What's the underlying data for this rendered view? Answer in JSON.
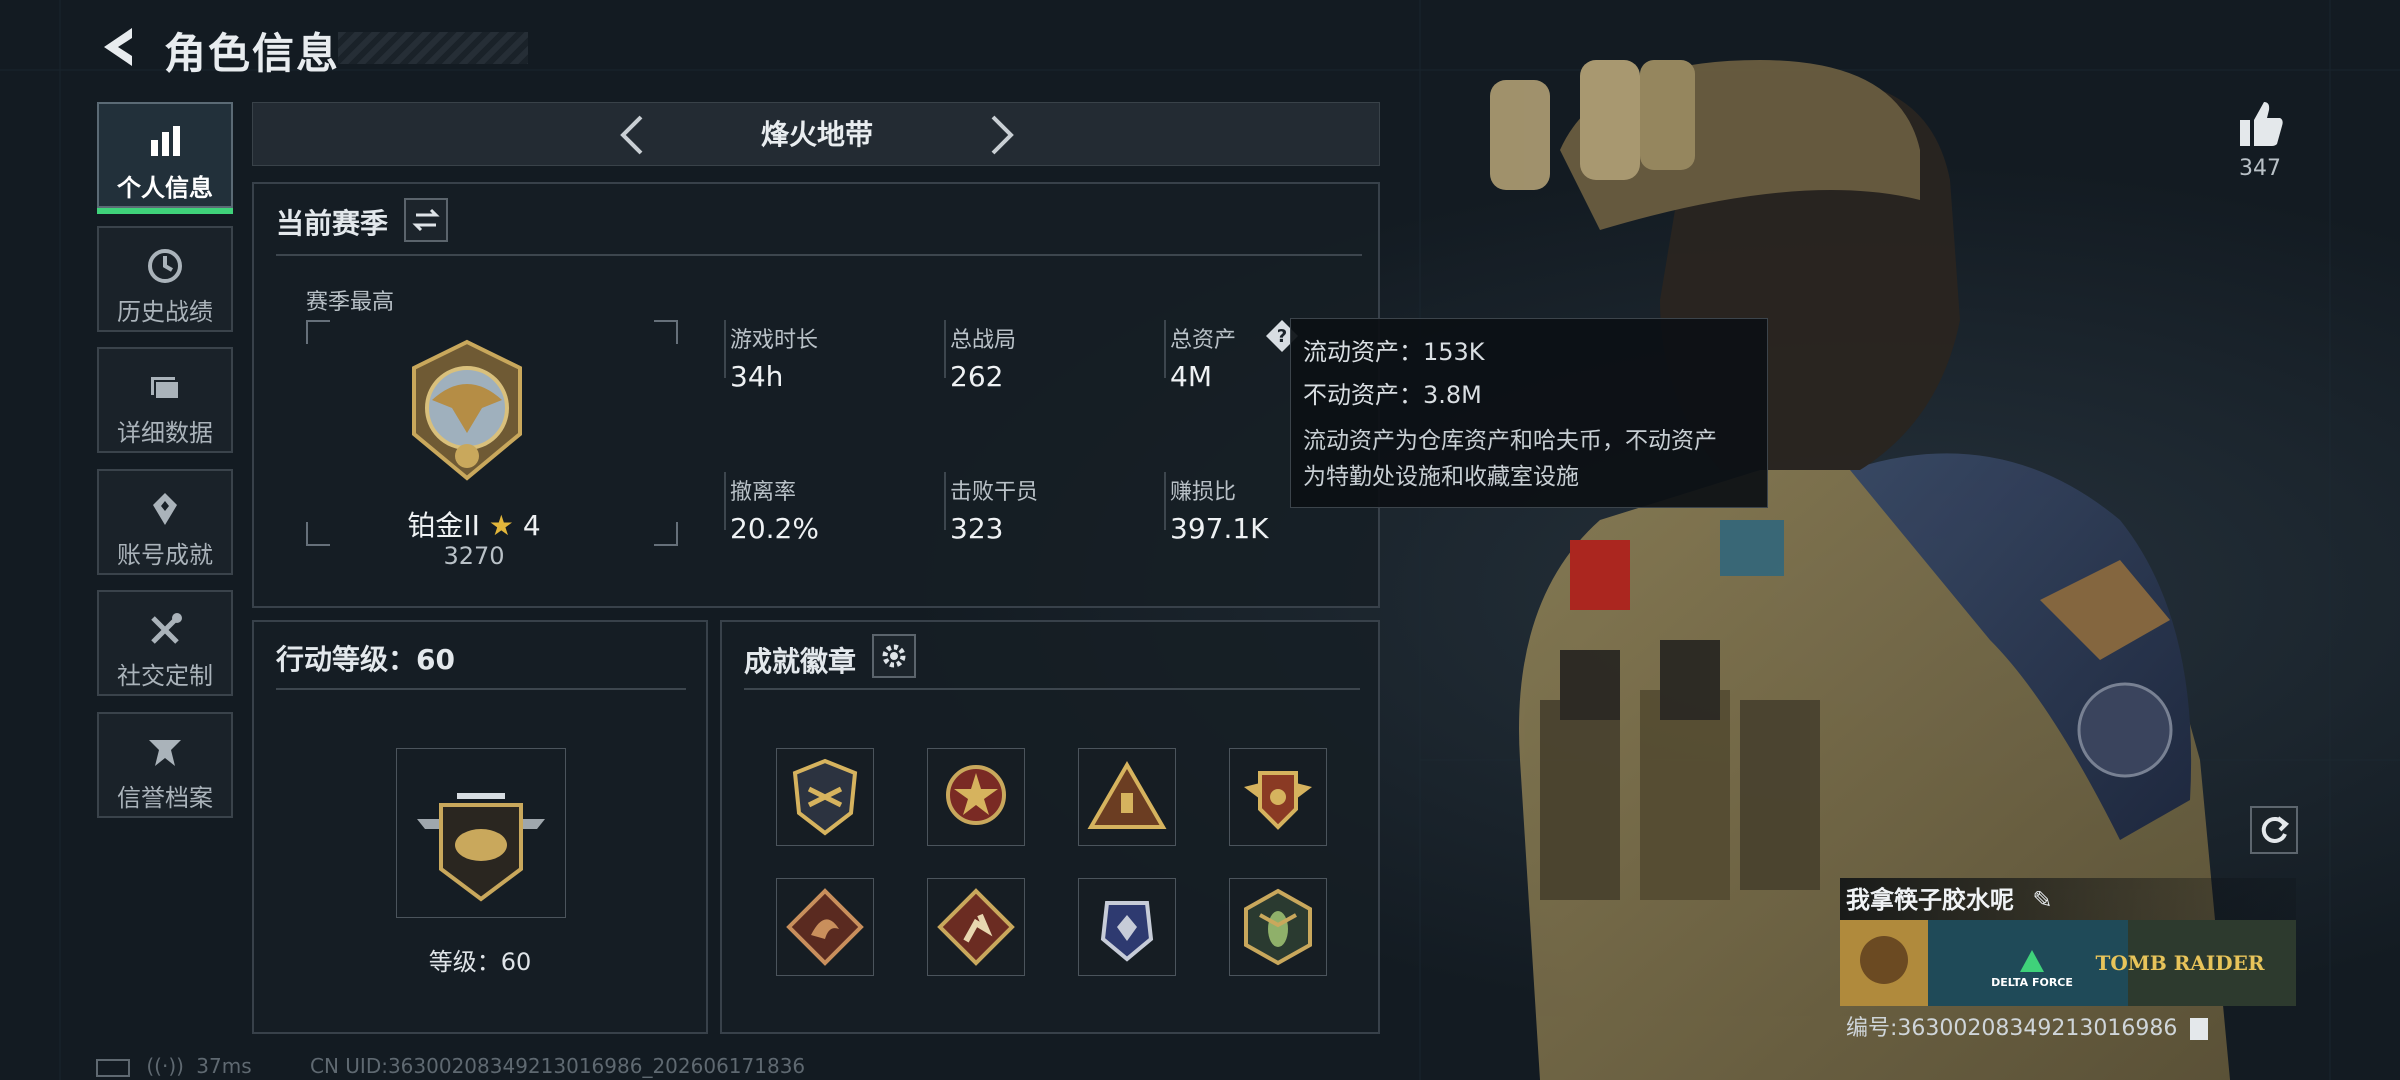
{
  "header": {
    "title": "角色信息"
  },
  "sidebar": {
    "items": [
      {
        "label": "个人信息",
        "icon": "bar-chart-icon",
        "active": true
      },
      {
        "label": "历史战绩",
        "icon": "history-clock-icon",
        "active": false
      },
      {
        "label": "详细数据",
        "icon": "folder-icon",
        "active": false
      },
      {
        "label": "账号成就",
        "icon": "achievement-icon",
        "active": false
      },
      {
        "label": "社交定制",
        "icon": "tools-icon",
        "active": false
      },
      {
        "label": "信誉档案",
        "icon": "reputation-icon",
        "active": false
      }
    ]
  },
  "mode_selector": {
    "name": "烽火地带",
    "prev_icon": "chevron-left-icon",
    "next_icon": "chevron-right-icon"
  },
  "season": {
    "title": "当前赛季",
    "swap_icon": "swap-arrows-icon",
    "best_label": "赛季最高",
    "rank_name": "铂金II",
    "rank_stars": "4",
    "rank_points": "3270",
    "stats": [
      {
        "label": "游戏时长",
        "value": "34h"
      },
      {
        "label": "总战局",
        "value": "262"
      },
      {
        "label": "总资产",
        "value": "4M",
        "help_icon": "question-icon"
      },
      {
        "label": "撤离率",
        "value": "20.2%"
      },
      {
        "label": "击败干员",
        "value": "323"
      },
      {
        "label": "赚损比",
        "value": "397.1K"
      }
    ]
  },
  "tooltip": {
    "line1": "流动资产：153K",
    "line2": "不动资产：3.8M",
    "desc1": "流动资产为仓库资产和哈夫币，不动资产",
    "desc2": "为特勤处设施和收藏室设施"
  },
  "action_level": {
    "title": "行动等级：60",
    "level_text": "等级：60"
  },
  "achievements": {
    "title": "成就徽章",
    "settings_icon": "gear-icon",
    "badges": [
      "shield-badge-icon",
      "star-cross-badge-icon",
      "triangle-badge-icon",
      "winged-shield-badge-icon",
      "dragon-badge-icon",
      "runner-badge-icon",
      "crest-badge-icon",
      "wasp-badge-icon"
    ]
  },
  "profile": {
    "likes": "347",
    "name": "我拿筷子胶水呢",
    "id_text": "编号:3630020834921301698​6",
    "banner_text1": "DELTA FORCE",
    "banner_text2": "TOMB RAIDER"
  },
  "footer": {
    "ping": "37ms",
    "uid": "CN UID:36300208349213016986_202606171836"
  },
  "colors": {
    "accent": "#3fd27a",
    "bg": "#131b22",
    "gold": "#c9a85c"
  }
}
